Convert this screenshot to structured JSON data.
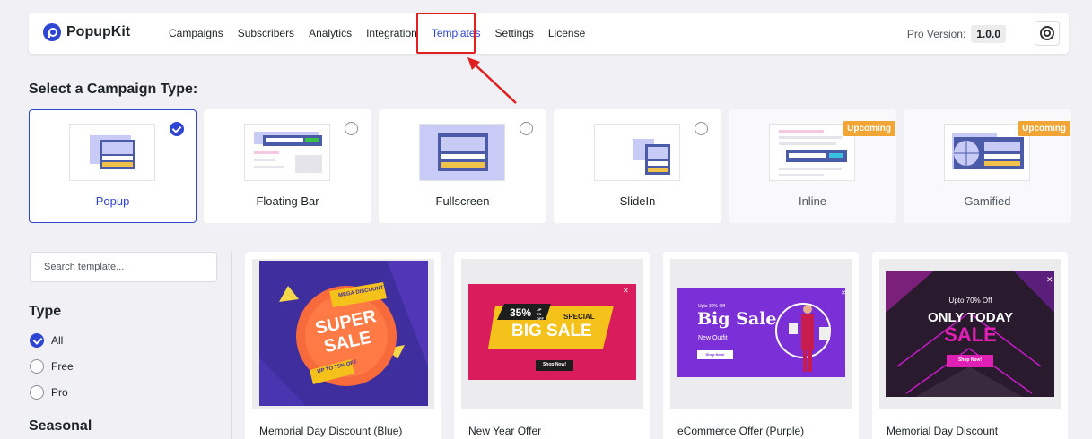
{
  "brand": {
    "name": "PopupKit"
  },
  "nav": {
    "items": [
      {
        "label": "Campaigns"
      },
      {
        "label": "Subscribers"
      },
      {
        "label": "Analytics"
      },
      {
        "label": "Integration"
      },
      {
        "label": "Templates"
      },
      {
        "label": "Settings"
      },
      {
        "label": "License"
      }
    ],
    "active_index": 4
  },
  "header": {
    "pro_label": "Pro Version:",
    "version": "1.0.0",
    "help_icon": "lifebuoy-icon"
  },
  "campaign_section": {
    "title": "Select a Campaign Type:"
  },
  "campaign_types": [
    {
      "label": "Popup",
      "selected": true,
      "badge": ""
    },
    {
      "label": "Floating Bar",
      "selected": false,
      "badge": ""
    },
    {
      "label": "Fullscreen",
      "selected": false,
      "badge": ""
    },
    {
      "label": "SlideIn",
      "selected": false,
      "badge": ""
    },
    {
      "label": "Inline",
      "selected": false,
      "badge": "Upcoming"
    },
    {
      "label": "Gamified",
      "selected": false,
      "badge": "Upcoming"
    }
  ],
  "sidebar": {
    "search_placeholder": "Search template...",
    "type_title": "Type",
    "type_options": [
      {
        "label": "All",
        "checked": true
      },
      {
        "label": "Free",
        "checked": false
      },
      {
        "label": "Pro",
        "checked": false
      }
    ],
    "seasonal_title": "Seasonal"
  },
  "templates": [
    {
      "name": "Memorial Day Discount (Blue)",
      "art": {
        "badge": "MEGA DISCOUNT",
        "line1": "SUPER",
        "line2": "SALE",
        "ribbon": "UP TO 75% OFF"
      }
    },
    {
      "name": "New Year Offer",
      "art": {
        "percent": "35%",
        "percent_sub": "UP TO OFF",
        "special": "SPECIAL",
        "headline": "BIG SALE",
        "button": "Shop Now!"
      }
    },
    {
      "name": "eCommerce Offer (Purple)",
      "art": {
        "kicker": "Upto 30% Off",
        "headline": "Big Sale",
        "sub": "New Outfit",
        "button": "Shop Now!"
      }
    },
    {
      "name": "Memorial Day Discount",
      "art": {
        "kicker": "Upto 70% Off",
        "line1": "ONLY TODAY",
        "line2": "SALE",
        "button": "Shop Now!"
      }
    }
  ],
  "colors": {
    "accent": "#2f45d3",
    "badge": "#f0a535",
    "highlight": "#e01f1f"
  }
}
